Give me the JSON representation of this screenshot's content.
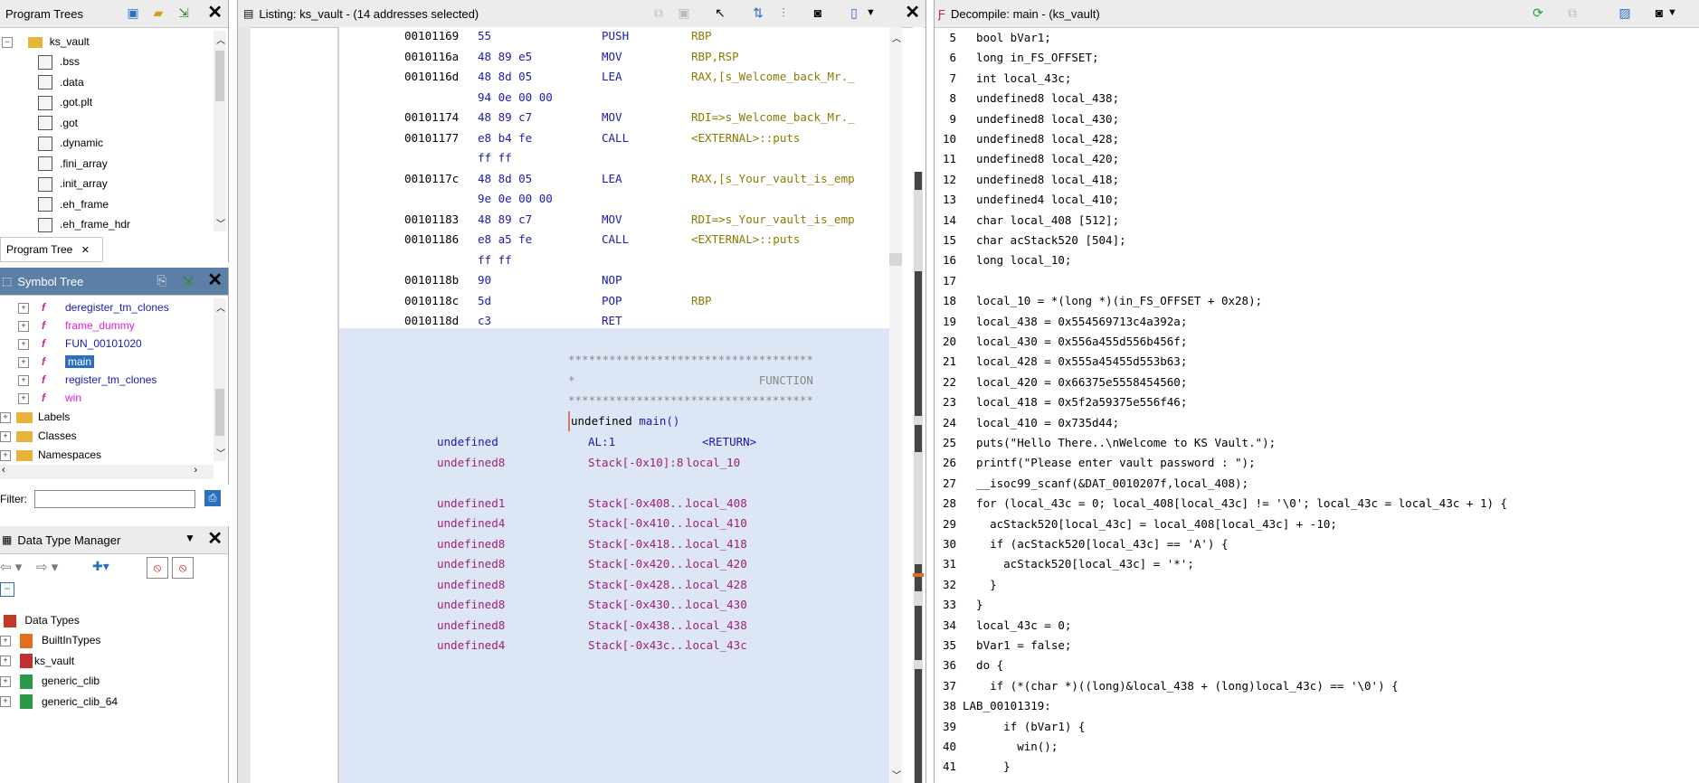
{
  "program_trees": {
    "title": "Program Trees",
    "root": "ks_vault",
    "items": [
      ".bss",
      ".data",
      ".got.plt",
      ".got",
      ".dynamic",
      ".fini_array",
      ".init_array",
      ".eh_frame",
      ".eh_frame_hdr"
    ],
    "tab_label": "Program Tree"
  },
  "symbol_tree": {
    "title": "Symbol Tree",
    "functions": [
      {
        "label": "deregister_tm_clones",
        "color": "#1a1ab0"
      },
      {
        "label": "frame_dummy",
        "color": "#e020e0"
      },
      {
        "label": "FUN_00101020",
        "color": "#1a1ab0"
      },
      {
        "label": "main",
        "color": "#ffffff"
      },
      {
        "label": "register_tm_clones",
        "color": "#1a1ab0"
      },
      {
        "label": "win",
        "color": "#e020e0"
      }
    ],
    "folders": [
      "Labels",
      "Classes",
      "Namespaces"
    ],
    "filter_label": "Filter:"
  },
  "data_type_manager": {
    "title": "Data Type Manager",
    "root": "Data Types",
    "items": [
      "BuiltInTypes",
      "ks_vault",
      "generic_clib",
      "generic_clib_64"
    ]
  },
  "listing": {
    "title": "Listing:  ks_vault - (14 addresses selected)",
    "rows": [
      {
        "addr": "00101169",
        "bytes": "55",
        "mnem": "PUSH",
        "ops": "RBP"
      },
      {
        "addr": "0010116a",
        "bytes": "48 89 e5",
        "mnem": "MOV",
        "ops": "RBP,RSP"
      },
      {
        "addr": "0010116d",
        "bytes": "48 8d 05",
        "mnem": "LEA",
        "ops": "RAX,[s_Welcome_back_Mr._"
      },
      {
        "addr": "",
        "bytes": "94 0e 00 00",
        "mnem": "",
        "ops": ""
      },
      {
        "addr": "00101174",
        "bytes": "48 89 c7",
        "mnem": "MOV",
        "ops": "RDI=>s_Welcome_back_Mr._"
      },
      {
        "addr": "00101177",
        "bytes": "e8 b4 fe",
        "mnem": "CALL",
        "ops": "<EXTERNAL>::puts"
      },
      {
        "addr": "",
        "bytes": "ff ff",
        "mnem": "",
        "ops": ""
      },
      {
        "addr": "0010117c",
        "bytes": "48 8d 05",
        "mnem": "LEA",
        "ops": "RAX,[s_Your_vault_is_emp"
      },
      {
        "addr": "",
        "bytes": "9e 0e 00 00",
        "mnem": "",
        "ops": ""
      },
      {
        "addr": "00101183",
        "bytes": "48 89 c7",
        "mnem": "MOV",
        "ops": "RDI=>s_Your_vault_is_emp"
      },
      {
        "addr": "00101186",
        "bytes": "e8 a5 fe",
        "mnem": "CALL",
        "ops": "<EXTERNAL>::puts"
      },
      {
        "addr": "",
        "bytes": "ff ff",
        "mnem": "",
        "ops": ""
      },
      {
        "addr": "0010118b",
        "bytes": "90",
        "mnem": "NOP",
        "ops": ""
      },
      {
        "addr": "0010118c",
        "bytes": "5d",
        "mnem": "POP",
        "ops": "RBP"
      },
      {
        "addr": "0010118d",
        "bytes": "c3",
        "mnem": "RET",
        "ops": ""
      }
    ],
    "stars": "************************************",
    "function_banner": "*                           FUNCTION",
    "signature_type": "undefined",
    "signature_name": "main()",
    "params": [
      {
        "type": "undefined",
        "storage": "AL:1",
        "name": "<RETURN>"
      },
      {
        "type": "undefined8",
        "storage": "Stack[-0x10]:8",
        "name": "local_10"
      },
      {
        "type": "undefined1",
        "storage": "Stack[-0x408...",
        "name": "local_408"
      },
      {
        "type": "undefined4",
        "storage": "Stack[-0x410...",
        "name": "local_410"
      },
      {
        "type": "undefined8",
        "storage": "Stack[-0x418...",
        "name": "local_418"
      },
      {
        "type": "undefined8",
        "storage": "Stack[-0x420...",
        "name": "local_420"
      },
      {
        "type": "undefined8",
        "storage": "Stack[-0x428...",
        "name": "local_428"
      },
      {
        "type": "undefined8",
        "storage": "Stack[-0x430...",
        "name": "local_430"
      },
      {
        "type": "undefined8",
        "storage": "Stack[-0x438...",
        "name": "local_438"
      },
      {
        "type": "undefined4",
        "storage": "Stack[-0x43c...",
        "name": "local_43c"
      }
    ]
  },
  "decompile": {
    "title": "Decompile: main -  (ks_vault)",
    "lines": [
      {
        "n": "5",
        "t": "  bool bVar1;"
      },
      {
        "n": "6",
        "t": "  long in_FS_OFFSET;"
      },
      {
        "n": "7",
        "t": "  int local_43c;"
      },
      {
        "n": "8",
        "t": "  undefined8 local_438;"
      },
      {
        "n": "9",
        "t": "  undefined8 local_430;"
      },
      {
        "n": "10",
        "t": "  undefined8 local_428;"
      },
      {
        "n": "11",
        "t": "  undefined8 local_420;"
      },
      {
        "n": "12",
        "t": "  undefined8 local_418;"
      },
      {
        "n": "13",
        "t": "  undefined4 local_410;"
      },
      {
        "n": "14",
        "t": "  char local_408 [512];"
      },
      {
        "n": "15",
        "t": "  char acStack520 [504];"
      },
      {
        "n": "16",
        "t": "  long local_10;"
      },
      {
        "n": "17",
        "t": ""
      },
      {
        "n": "18",
        "t": "  local_10 = *(long *)(in_FS_OFFSET + 0x28);"
      },
      {
        "n": "19",
        "t": "  local_438 = 0x554569713c4a392a;"
      },
      {
        "n": "20",
        "t": "  local_430 = 0x556a455d556b456f;"
      },
      {
        "n": "21",
        "t": "  local_428 = 0x555a45455d553b63;"
      },
      {
        "n": "22",
        "t": "  local_420 = 0x66375e5558454560;"
      },
      {
        "n": "23",
        "t": "  local_418 = 0x5f2a59375e556f46;"
      },
      {
        "n": "24",
        "t": "  local_410 = 0x735d44;"
      },
      {
        "n": "25",
        "t": "  puts(\"Hello There..\\nWelcome to KS Vault.\");"
      },
      {
        "n": "26",
        "t": "  printf(\"Please enter vault password : \");"
      },
      {
        "n": "27",
        "t": "  __isoc99_scanf(&DAT_0010207f,local_408);"
      },
      {
        "n": "28",
        "t": "  for (local_43c = 0; local_408[local_43c] != '\\0'; local_43c = local_43c + 1) {"
      },
      {
        "n": "29",
        "t": "    acStack520[local_43c] = local_408[local_43c] + -10;"
      },
      {
        "n": "30",
        "t": "    if (acStack520[local_43c] == 'A') {"
      },
      {
        "n": "31",
        "t": "      acStack520[local_43c] = '*';"
      },
      {
        "n": "32",
        "t": "    }"
      },
      {
        "n": "33",
        "t": "  }"
      },
      {
        "n": "34",
        "t": "  local_43c = 0;"
      },
      {
        "n": "35",
        "t": "  bVar1 = false;"
      },
      {
        "n": "36",
        "t": "  do {"
      },
      {
        "n": "37",
        "t": "    if (*(char *)((long)&local_438 + (long)local_43c) == '\\0') {"
      },
      {
        "n": "38",
        "t": "LAB_00101319:"
      },
      {
        "n": "39",
        "t": "      if (bVar1) {"
      },
      {
        "n": "40",
        "t": "        win();"
      },
      {
        "n": "41",
        "t": "      }"
      }
    ]
  }
}
